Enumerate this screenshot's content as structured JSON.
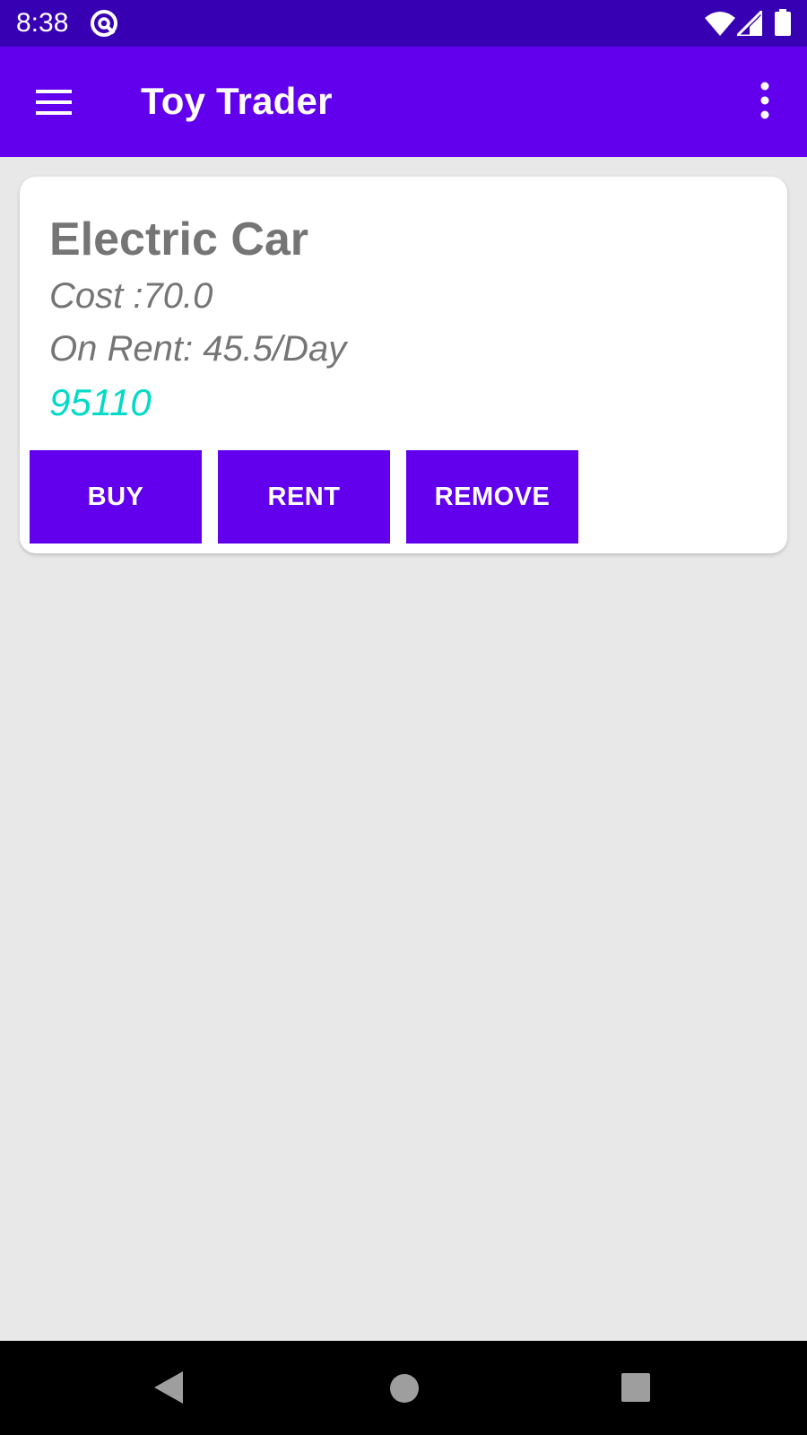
{
  "status_bar": {
    "time": "8:38",
    "app_icon": "at-sign-icon",
    "wifi_icon": "wifi-icon",
    "signal_icon": "cell-signal-icon",
    "battery_icon": "battery-icon"
  },
  "app_bar": {
    "title": "Toy Trader",
    "menu_icon": "hamburger-menu-icon",
    "overflow_icon": "more-vert-icon",
    "color": "#6200ee"
  },
  "toy": {
    "name": "Electric Car",
    "cost": "Cost :70.0",
    "rent": "On Rent: 45.5/Day",
    "code": "95110",
    "code_color": "#03dac5"
  },
  "actions": {
    "buy_label": "BUY",
    "rent_label": "RENT",
    "remove_label": "REMOVE"
  },
  "nav_bar": {
    "back_icon": "back-triangle-icon",
    "home_icon": "home-circle-icon",
    "recents_icon": "recents-square-icon"
  }
}
